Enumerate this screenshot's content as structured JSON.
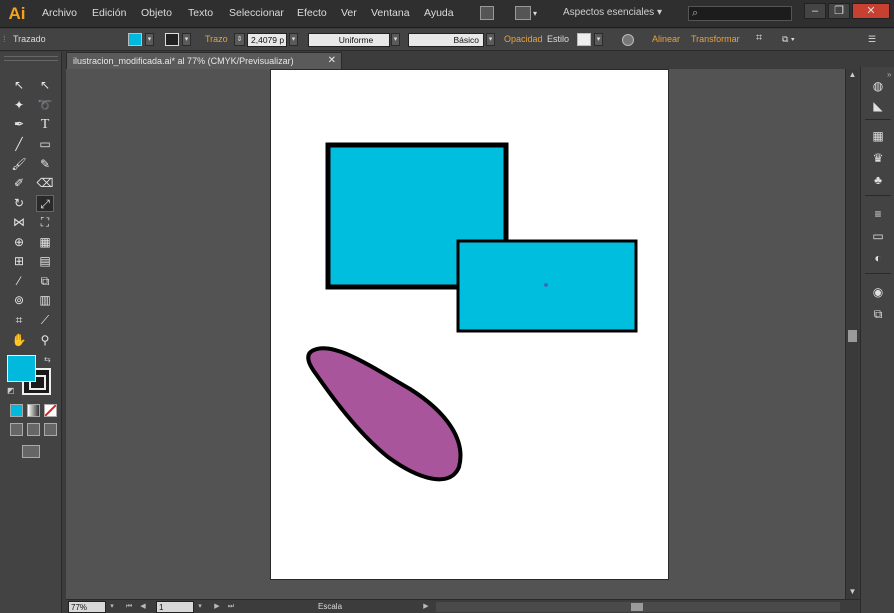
{
  "app": {
    "logo_text": "Ai",
    "menus": [
      "Archivo",
      "Edición",
      "Objeto",
      "Texto",
      "Seleccionar",
      "Efecto",
      "Ver",
      "Ventana",
      "Ayuda"
    ],
    "workspace_label": "Aspectos esenciales",
    "search_placeholder": "",
    "window_buttons": {
      "minimize": "–",
      "restore": "❐",
      "close": "✕"
    }
  },
  "control_bar": {
    "selection_label": "Trazado",
    "fill_color": "#00b9dc",
    "stroke_label": "Trazo",
    "stroke_weight": "2,4079 p",
    "stroke_profile": "Uniforme",
    "brush": "Básico",
    "opacity_label": "Opacidad",
    "style_label": "Estilo",
    "align_label": "Alinear",
    "transform_label": "Transformar"
  },
  "document": {
    "tab_title": "ilustracion_modificada.ai* al 77% (CMYK/Previsualizar)",
    "close_glyph": "✕"
  },
  "tools": {
    "fill_color": "#00b9dc",
    "stroke_color": "#1a1a1a",
    "selected_tool": "scale-tool",
    "type_glyph": "T"
  },
  "artwork": {
    "rect_fill": "#00bfde",
    "ellipse_fill": "#a8559b",
    "stroke_color": "#000000"
  },
  "status_bar": {
    "zoom": "77%",
    "artboard_number": "1",
    "current_tool": "Escala"
  }
}
